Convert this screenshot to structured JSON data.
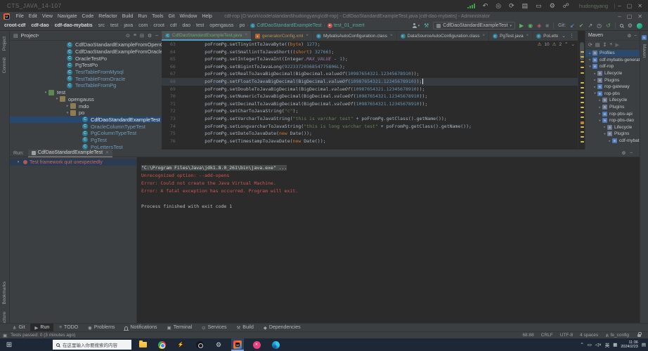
{
  "window_controls": [
    {
      "name": "minimize-button",
      "glyph": "–"
    },
    {
      "name": "restore-button",
      "glyph": "▢"
    },
    {
      "name": "close-button",
      "glyph": "✕"
    }
  ],
  "remote_bar": {
    "title": "CTS_JAVA_14-107",
    "user": "hudongyang",
    "icons": [
      {
        "name": "signal-icon"
      },
      {
        "name": "back-icon",
        "glyph": "↶"
      },
      {
        "name": "power-icon",
        "glyph": "◎"
      },
      {
        "name": "sync-icon",
        "glyph": "⟳"
      },
      {
        "name": "apps-icon",
        "glyph": "▤"
      },
      {
        "name": "display-icon",
        "glyph": "▭"
      },
      {
        "name": "gear-icon",
        "glyph": "⚙"
      },
      {
        "name": "user-switch-icon",
        "glyph": "☍"
      }
    ]
  },
  "menu_bar": {
    "menus": [
      "File",
      "Edit",
      "View",
      "Navigate",
      "Code",
      "Refactor",
      "Build",
      "Run",
      "Tools",
      "Git",
      "Window",
      "Help"
    ],
    "title": "cdf-rop [D:\\work\\code\\standard\\hudongyang\\cdf-rop] - CdfDaoStandardExampleTest.java [cdf-dao-mybatis] - Administrator"
  },
  "nav_bar": {
    "crumbs": [
      {
        "label": "croot-cdf",
        "style": "module"
      },
      {
        "label": "cdf-dao",
        "style": "module"
      },
      {
        "label": "cdf-dao-mybatis",
        "style": "module"
      },
      {
        "label": "src"
      },
      {
        "label": "test"
      },
      {
        "label": "java"
      },
      {
        "label": "com"
      },
      {
        "label": "croot"
      },
      {
        "label": "cdf"
      },
      {
        "label": "dao"
      },
      {
        "label": "test"
      },
      {
        "label": "opengauss"
      },
      {
        "label": "po"
      },
      {
        "label": "CdfDaoStandardExampleTest",
        "style": "class",
        "icon": "class"
      },
      {
        "label": "test_01_insert",
        "style": "method",
        "icon": "run-method"
      }
    ],
    "run_config": "CdfDaoStandardExampleTest",
    "actions": [
      {
        "name": "user-button"
      },
      {
        "name": "wrench-button",
        "glyph": "⚒",
        "color": "#4db6ac"
      },
      {
        "name": "run-config-selector"
      },
      {
        "name": "run-button",
        "glyph": "▶",
        "color": "#5caf5e"
      },
      {
        "name": "debug-button",
        "glyph": "◉",
        "color": "#5caf5e"
      },
      {
        "name": "coverage-button",
        "glyph": "◈",
        "color": "#b0635a"
      },
      {
        "name": "stop-button",
        "glyph": "■",
        "color": "#6a6e71"
      },
      {
        "sep": true
      },
      {
        "name": "git-label",
        "text": "Git:"
      },
      {
        "name": "git-update-button",
        "glyph": "↙",
        "color": "#5f9ee7"
      },
      {
        "name": "git-commit-button",
        "glyph": "✔",
        "color": "#62a762"
      },
      {
        "name": "git-push-button",
        "glyph": "↗",
        "color": "#9aa7b0"
      },
      {
        "name": "git-history-button",
        "glyph": "◷",
        "color": "#9aa7b0"
      },
      {
        "name": "git-rollback-button",
        "glyph": "↺",
        "color": "#62a762"
      },
      {
        "sep": true
      },
      {
        "name": "search-button"
      },
      {
        "name": "settings-button",
        "glyph": "⚙",
        "color": "#9aa7b0"
      },
      {
        "name": "plugin-button"
      }
    ]
  },
  "left_stripe": {
    "top": [
      {
        "label": "Project"
      },
      {
        "label": "Commit"
      }
    ],
    "bottom": [
      {
        "label": "Bookmarks"
      },
      {
        "label": "Structure"
      }
    ]
  },
  "right_stripe": {
    "label": "Maven"
  },
  "project_panel": {
    "header": {
      "title": "Project",
      "chevron": "▾",
      "icons": [
        {
          "name": "locate-icon",
          "glyph": "⊙"
        },
        {
          "name": "scroll-to-source-icon",
          "glyph": "≡"
        },
        {
          "name": "collapse-all-icon",
          "glyph": "⊟"
        },
        {
          "name": "gear-icon",
          "glyph": "⚙"
        },
        {
          "name": "hide-icon",
          "glyph": "–"
        }
      ]
    },
    "tree": [
      {
        "label": "CdfDaoStandardExampleFromOpenGauss",
        "icon": "class",
        "indent": 73
      },
      {
        "label": "CdfDaoStandardExampleFromOracle",
        "icon": "class",
        "indent": 73
      },
      {
        "label": "OracleTestPo",
        "icon": "class",
        "indent": 73
      },
      {
        "label": "PgTestPo",
        "icon": "class",
        "indent": 73
      },
      {
        "label": "TestTableFromMysql",
        "icon": "class",
        "indent": 73,
        "color": "#6d9cbe"
      },
      {
        "label": "TestTableFromOracle",
        "icon": "class",
        "indent": 73,
        "color": "#6d9cbe"
      },
      {
        "label": "TestTableFromPg",
        "icon": "class",
        "indent": 73,
        "color": "#6d9cbe"
      },
      {
        "label": "test",
        "icon": "folder-test",
        "indent": 47,
        "chevron": "▾"
      },
      {
        "label": "opengauss",
        "icon": "package",
        "indent": 63,
        "chevron": "▾"
      },
      {
        "label": "mdo",
        "icon": "package",
        "indent": 78,
        "chevron": "▸"
      },
      {
        "label": "po",
        "icon": "package",
        "indent": 78,
        "chevron": "▾"
      },
      {
        "label": "CdfDaoStandardExampleTest",
        "icon": "class",
        "indent": 95,
        "selected": true
      },
      {
        "label": "OracleColumnTypeTest",
        "icon": "class",
        "indent": 95,
        "color": "#6d9cbe"
      },
      {
        "label": "PgColumnTypeTest",
        "icon": "class",
        "indent": 95,
        "color": "#6d9cbe"
      },
      {
        "label": "PgTest",
        "icon": "class",
        "indent": 95,
        "color": "#6d9cbe"
      },
      {
        "label": "PoLettersTest",
        "icon": "class",
        "indent": 95,
        "color": "#6d9cbe"
      }
    ]
  },
  "tabs": [
    {
      "label": "CdfDaoStandardExampleTest.java",
      "icon": "class",
      "selected": true,
      "color": "#69a86f"
    },
    {
      "label": "generatorConfig.xml",
      "icon": "xml",
      "color": "#bc8f4f"
    },
    {
      "label": "MybatisAutoConfiguration.class",
      "icon": "class",
      "color": "#bbbbbb"
    },
    {
      "label": "DataSourceAutoConfiguration.class",
      "icon": "class",
      "color": "#bbbbbb"
    },
    {
      "label": "PgTest.java",
      "icon": "class",
      "color": "#bbbbbb"
    },
    {
      "label": "PoLettersTest.java",
      "icon": "class",
      "color": "#bbbbbb"
    }
  ],
  "editor": {
    "current_line": "68",
    "inspection": {
      "warnings": "10",
      "weak_warnings": "2",
      "up": "⌃",
      "down": "⌄"
    },
    "lines": [
      {
        "no": "63",
        "tokens": [
          [
            "p",
            "        poFromPg.setTinyintToJavaByte(("
          ],
          [
            "k",
            "byte"
          ],
          [
            "p",
            ") "
          ],
          [
            "n",
            "127"
          ],
          [
            "p",
            ");"
          ]
        ]
      },
      {
        "no": "64",
        "tokens": [
          [
            "p",
            "        poFromPg.setSmallintToJavaShort(("
          ],
          [
            "k",
            "short"
          ],
          [
            "p",
            ") "
          ],
          [
            "n",
            "32766"
          ],
          [
            "p",
            ");"
          ]
        ]
      },
      {
        "no": "65",
        "tokens": [
          [
            "p",
            "        poFromPg.setIntegerToJavaInt(Integer."
          ],
          [
            "f",
            "MAX_VALUE"
          ],
          [
            "p",
            " - "
          ],
          [
            "n",
            "1"
          ],
          [
            "p",
            ");"
          ]
        ]
      },
      {
        "no": "66",
        "tokens": [
          [
            "p",
            "        poFromPg.setBigintToJavaLong("
          ],
          [
            "n",
            "9223372036854775806L"
          ],
          [
            "p",
            ");"
          ]
        ]
      },
      {
        "no": "67",
        "tokens": [
          [
            "p",
            "        poFromPg.setRealToJavaBigDecimal(BigDecimal."
          ],
          [
            "sm",
            "valueOf"
          ],
          [
            "p",
            "("
          ],
          [
            "n",
            "10987654321.12345678910"
          ],
          [
            "p",
            "));"
          ]
        ]
      },
      {
        "no": "68",
        "tokens": [
          [
            "p",
            "        poFromPg.setFloatToJavaBigDecimal(BigDecimal."
          ],
          [
            "sm",
            "valueOf"
          ],
          [
            "p",
            "("
          ],
          [
            "n",
            "10987654321.12345678910"
          ],
          [
            "p",
            "));"
          ]
        ]
      },
      {
        "no": "69",
        "tokens": [
          [
            "p",
            "        poFromPg.setDoubleToJavaBigDecimal(BigDecimal."
          ],
          [
            "sm",
            "valueOf"
          ],
          [
            "p",
            "("
          ],
          [
            "n",
            "10987654321.12345678910"
          ],
          [
            "p",
            "));"
          ]
        ]
      },
      {
        "no": "70",
        "tokens": [
          [
            "p",
            "        poFromPg.setNumericToJavaBigDecimal(BigDecimal."
          ],
          [
            "sm",
            "valueOf"
          ],
          [
            "p",
            "("
          ],
          [
            "n",
            "10987654321.12345678910"
          ],
          [
            "p",
            "));"
          ]
        ]
      },
      {
        "no": "71",
        "tokens": [
          [
            "p",
            "        poFromPg.setDecimalToJavaBigDecimal(BigDecimal."
          ],
          [
            "sm",
            "valueOf"
          ],
          [
            "p",
            "("
          ],
          [
            "n",
            "10987654321.12345678910"
          ],
          [
            "p",
            "));"
          ]
        ]
      },
      {
        "no": "72",
        "tokens": [
          [
            "p",
            "        poFromPg.setCharToJavaString("
          ],
          [
            "s",
            "\"c\""
          ],
          [
            "p",
            ");"
          ]
        ]
      },
      {
        "no": "73",
        "tokens": [
          [
            "p",
            "        poFromPg.setVarcharToJavaString("
          ],
          [
            "s",
            "\"this is varchar test\""
          ],
          [
            "p",
            " + poFromPg.getClass().getName());"
          ]
        ]
      },
      {
        "no": "74",
        "tokens": [
          [
            "p",
            "        poFromPg.setLongvarcharToJavaString("
          ],
          [
            "s",
            "\"this is long varchar test\""
          ],
          [
            "p",
            " + poFromPg.getClass().getName());"
          ]
        ]
      },
      {
        "no": "75",
        "tokens": [
          [
            "p",
            "        poFromPg.setDateToJavaDate("
          ],
          [
            "k",
            "new"
          ],
          [
            "p",
            " Date());"
          ]
        ]
      },
      {
        "no": "76",
        "tokens": [
          [
            "p",
            "        poFromPg.setTimestampToJavaDate("
          ],
          [
            "k",
            "new"
          ],
          [
            "p",
            " Date());"
          ]
        ]
      }
    ],
    "stripe_marks": [
      {
        "t": 15,
        "c": "y"
      },
      {
        "t": 22,
        "c": "y"
      },
      {
        "t": 29,
        "c": "y"
      },
      {
        "t": 37,
        "c": "y"
      },
      {
        "t": 45,
        "c": "y"
      },
      {
        "t": 59,
        "c": "y"
      },
      {
        "t": 66,
        "c": "y"
      },
      {
        "t": 73,
        "c": "y"
      },
      {
        "t": 80,
        "c": "y"
      },
      {
        "t": 87,
        "c": "y"
      },
      {
        "t": 94,
        "c": "y"
      },
      {
        "t": 101,
        "c": "y"
      },
      {
        "t": 108,
        "c": "y"
      },
      {
        "t": 115,
        "c": "o"
      },
      {
        "t": 122,
        "c": "y"
      },
      {
        "t": 129,
        "c": "y"
      },
      {
        "t": 136,
        "c": "y"
      },
      {
        "t": 143,
        "c": "y"
      }
    ]
  },
  "maven_panel": {
    "title": "Maven",
    "toolbar": [
      {
        "name": "refresh-icon",
        "glyph": "⟳"
      },
      {
        "name": "folder-icon",
        "glyph": "▤"
      },
      {
        "name": "download-sources-icon",
        "glyph": "↧"
      },
      {
        "name": "add-icon",
        "glyph": "+"
      },
      {
        "name": "run-maven-icon",
        "glyph": "▶",
        "color": "#666"
      }
    ],
    "tree": [
      {
        "label": "Profiles",
        "chevron": "▸",
        "icon": "folder-gear",
        "indent": 0,
        "selected": true
      },
      {
        "label": "cdf-mybatis-generator",
        "chevron": "▸",
        "icon": "maven",
        "indent": 0
      },
      {
        "label": "cdf-rop",
        "chevron": "▾",
        "icon": "maven",
        "indent": 0
      },
      {
        "label": "Lifecycle",
        "chevron": "▸",
        "icon": "folder-gear",
        "indent": 1
      },
      {
        "label": "Plugins",
        "chevron": "▸",
        "icon": "folder-gear",
        "indent": 1
      },
      {
        "label": "rop-gateway",
        "chevron": "▸",
        "icon": "maven",
        "indent": 1
      },
      {
        "label": "rop-pbs",
        "chevron": "▾",
        "icon": "maven",
        "indent": 1
      },
      {
        "label": "Lifecycle",
        "chevron": "▸",
        "icon": "folder-gear",
        "indent": 2
      },
      {
        "label": "Plugins",
        "chevron": "▸",
        "icon": "folder-gear",
        "indent": 2
      },
      {
        "label": "rop-pbs-api",
        "chevron": "▸",
        "icon": "maven",
        "indent": 2
      },
      {
        "label": "rop-pbs-dao",
        "chevron": "▾",
        "icon": "maven",
        "indent": 2
      },
      {
        "label": "Lifecycle",
        "chevron": "▸",
        "icon": "folder-gear",
        "indent": 3
      },
      {
        "label": "Plugins",
        "chevron": "▾",
        "icon": "folder-gear",
        "indent": 3
      },
      {
        "label": "cdf-mybat",
        "chevron": "▸",
        "icon": "maven",
        "indent": 4
      }
    ]
  },
  "run_panel": {
    "label": "Run:",
    "tab": {
      "title": "CdfDaoStandardExampleTest",
      "close": "✕"
    },
    "tree_item": {
      "chevron": "▾",
      "label": "Test framework quit unexpectedly"
    },
    "console": [
      {
        "text": "\"C:\\Program Files\\Java\\jdk1.8.0_261\\bin\\java.exe\" ...",
        "style": "selected"
      },
      {
        "text": "Unrecognized option: --add-opens",
        "style": "error"
      },
      {
        "text": "Error: Could not create the Java Virtual Machine.",
        "style": "error"
      },
      {
        "text": "Error: A fatal exception has occurred. Program will exit.",
        "style": "error"
      },
      {
        "text": "",
        "style": "plain"
      },
      {
        "text": "Process finished with exit code 1",
        "style": "plain"
      }
    ]
  },
  "bottom_bar": {
    "items": [
      {
        "label": "Git",
        "icon": "git-branch",
        "glyph": "⋔"
      },
      {
        "label": "Run",
        "icon": "run",
        "glyph": "▶",
        "active": true
      },
      {
        "label": "TODO",
        "icon": "todo-list",
        "glyph": "≡"
      },
      {
        "label": "Problems",
        "icon": "problems",
        "glyph": "◉"
      },
      {
        "label": "Notifications",
        "icon": "bell"
      },
      {
        "label": "Terminal",
        "icon": "terminal",
        "glyph": "▣"
      },
      {
        "label": "Services",
        "icon": "services",
        "glyph": "⊙"
      },
      {
        "label": "Build",
        "icon": "build-hammer",
        "glyph": "⚒"
      },
      {
        "label": "Dependencies",
        "icon": "dependencies",
        "glyph": "◆"
      }
    ]
  },
  "status_bar": {
    "message": "Tests passed: 0 (3 minutes ago)",
    "position": "68:88",
    "line_ending": "CRLF",
    "encoding": "UTF-8",
    "indent": "4 spaces",
    "branch": "fe_config",
    "branch_icon": "⋔",
    "window_icon": "▣"
  },
  "taskbar": {
    "start_icon": "⊞",
    "search": {
      "placeholder": "在这里输入你要搜索的内容"
    },
    "apps": [
      {
        "name": "file-explorer"
      },
      {
        "name": "chrome"
      },
      {
        "name": "lightning-app"
      },
      {
        "name": "game-bar"
      },
      {
        "name": "settings"
      },
      {
        "name": "intellij-idea",
        "active": true
      },
      {
        "name": "media-app"
      },
      {
        "name": "edge"
      }
    ],
    "tray": {
      "chevron": "⌃",
      "monitor": "▭",
      "mute": "◁×",
      "ime": "英",
      "keyboard": "▦",
      "time": "11:36",
      "date": "2024/2/23",
      "action_center": "▤"
    }
  },
  "icons": {
    "chevron_down": "⌄",
    "more_vert": "⋮",
    "gear": "⚙",
    "minimize": "–",
    "lightning": "⚡",
    "media_x": "✕"
  }
}
